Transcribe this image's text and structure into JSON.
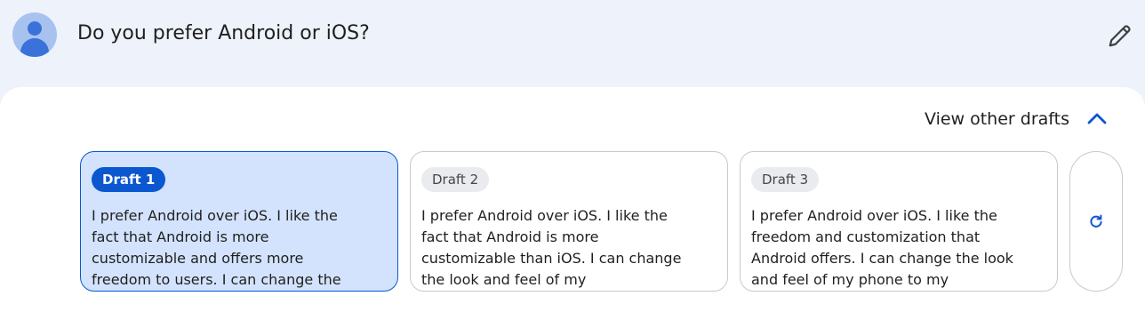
{
  "query": {
    "text": "Do you prefer Android or iOS?",
    "avatar_icon": "account-circle-icon",
    "edit_icon": "pencil-icon"
  },
  "drafts_panel": {
    "toggle_label": "View other drafts",
    "toggle_icon": "chevron-up-icon",
    "regenerate_icon": "refresh-icon",
    "accent_color": "#0b57d0",
    "drafts": [
      {
        "label": "Draft 1",
        "selected": true,
        "text": "I prefer Android over iOS. I like the fact that Android is more customizable and offers more freedom to users. I can change the"
      },
      {
        "label": "Draft 2",
        "selected": false,
        "text": "I prefer Android over iOS. I like the fact that Android is more customizable than iOS. I can change the look and feel of my"
      },
      {
        "label": "Draft 3",
        "selected": false,
        "text": "I prefer Android over iOS. I like the freedom and customization that Android offers. I can change the look and feel of my phone to my"
      }
    ]
  }
}
